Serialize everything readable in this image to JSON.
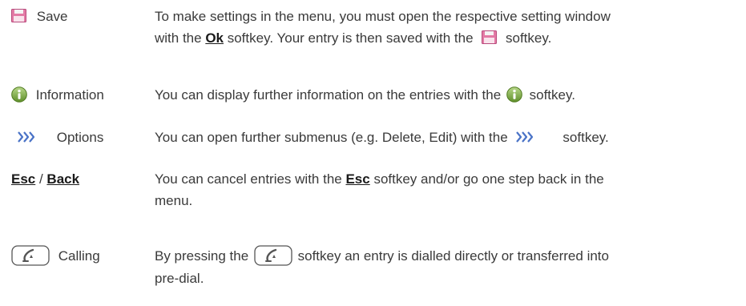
{
  "rows": [
    {
      "term": "Save",
      "icon": "save-icon",
      "desc_a": "To make settings in the menu, you must open the respective setting window with the ",
      "key": "Ok",
      "desc_b": " softkey. Your entry is then saved with the ",
      "desc_c": " softkey."
    },
    {
      "term": "Information",
      "icon": "info-icon",
      "desc_a": "You can display further information on the entries with the ",
      "desc_b": " softkey."
    },
    {
      "term": "Options",
      "icon": "options-icon",
      "desc_a": "You can open further submenus (e.g. Delete, Edit) with the ",
      "desc_b": "softkey."
    },
    {
      "term_esc": "Esc",
      "term_sep": " / ",
      "term_back": "Back",
      "desc_a": "You can cancel entries with the ",
      "key": "Esc",
      "desc_b": " softkey and/or go one step back in the menu."
    },
    {
      "term": "Calling",
      "icon": "call-softkey-icon",
      "desc_a": "By pressing the ",
      "desc_b": " softkey an entry is dialled directly or transferred into pre-dial."
    }
  ]
}
